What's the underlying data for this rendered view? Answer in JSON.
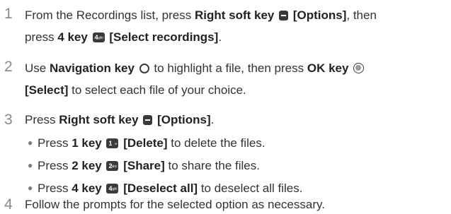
{
  "steps": [
    {
      "number": "1",
      "line1": {
        "t1": "From the Recordings list, press ",
        "b1": "Right soft key",
        "icon1": "right-soft-key-icon",
        "b2": "[Options]",
        "t2": ", then"
      },
      "line2": {
        "t1": "press ",
        "b1": "4 key",
        "key_digit": "4",
        "key_letters": "ghi",
        "b2": "[Select recordings]",
        "t2": "."
      }
    },
    {
      "number": "2",
      "line1": {
        "t1": "Use ",
        "b1": "Navigation key",
        "icon1": "navigation-key-icon",
        "t2": " to highlight a file, then press ",
        "b2": "OK key",
        "icon2": "ok-key-icon"
      },
      "line2": {
        "b1": "[Select]",
        "t1": " to select each file of your choice."
      }
    },
    {
      "number": "3",
      "line1": {
        "t1": "Press ",
        "b1": "Right soft key",
        "icon1": "right-soft-key-icon",
        "b2": "[Options]",
        "t2": "."
      },
      "subs": [
        {
          "t1": "Press ",
          "b1": "1 key",
          "key_digit": "1",
          "key_letters": "∞",
          "b2": "[Delete]",
          "t2": " to delete the files."
        },
        {
          "t1": "Press ",
          "b1": "2 key",
          "key_digit": "2",
          "key_letters": "abc",
          "b2": "[Share]",
          "t2": " to share the files."
        },
        {
          "t1": "Press ",
          "b1": "4 key",
          "key_digit": "4",
          "key_letters": "ghi",
          "b2": "[Deselect all]",
          "t2": " to deselect all files."
        }
      ]
    },
    {
      "number": "4",
      "line1": {
        "t1": "Follow the prompts for the selected option as necessary."
      }
    }
  ]
}
